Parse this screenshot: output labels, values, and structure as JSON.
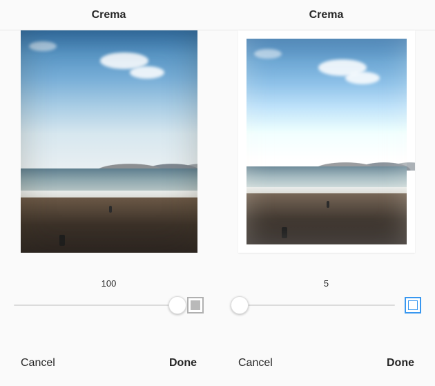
{
  "panes": [
    {
      "title": "Crema",
      "slider_value": "100",
      "slider_percent": 100,
      "frame_active": false,
      "cancel_label": "Cancel",
      "done_label": "Done"
    },
    {
      "title": "Crema",
      "slider_value": "5",
      "slider_percent": 5,
      "frame_active": true,
      "cancel_label": "Cancel",
      "done_label": "Done"
    }
  ]
}
